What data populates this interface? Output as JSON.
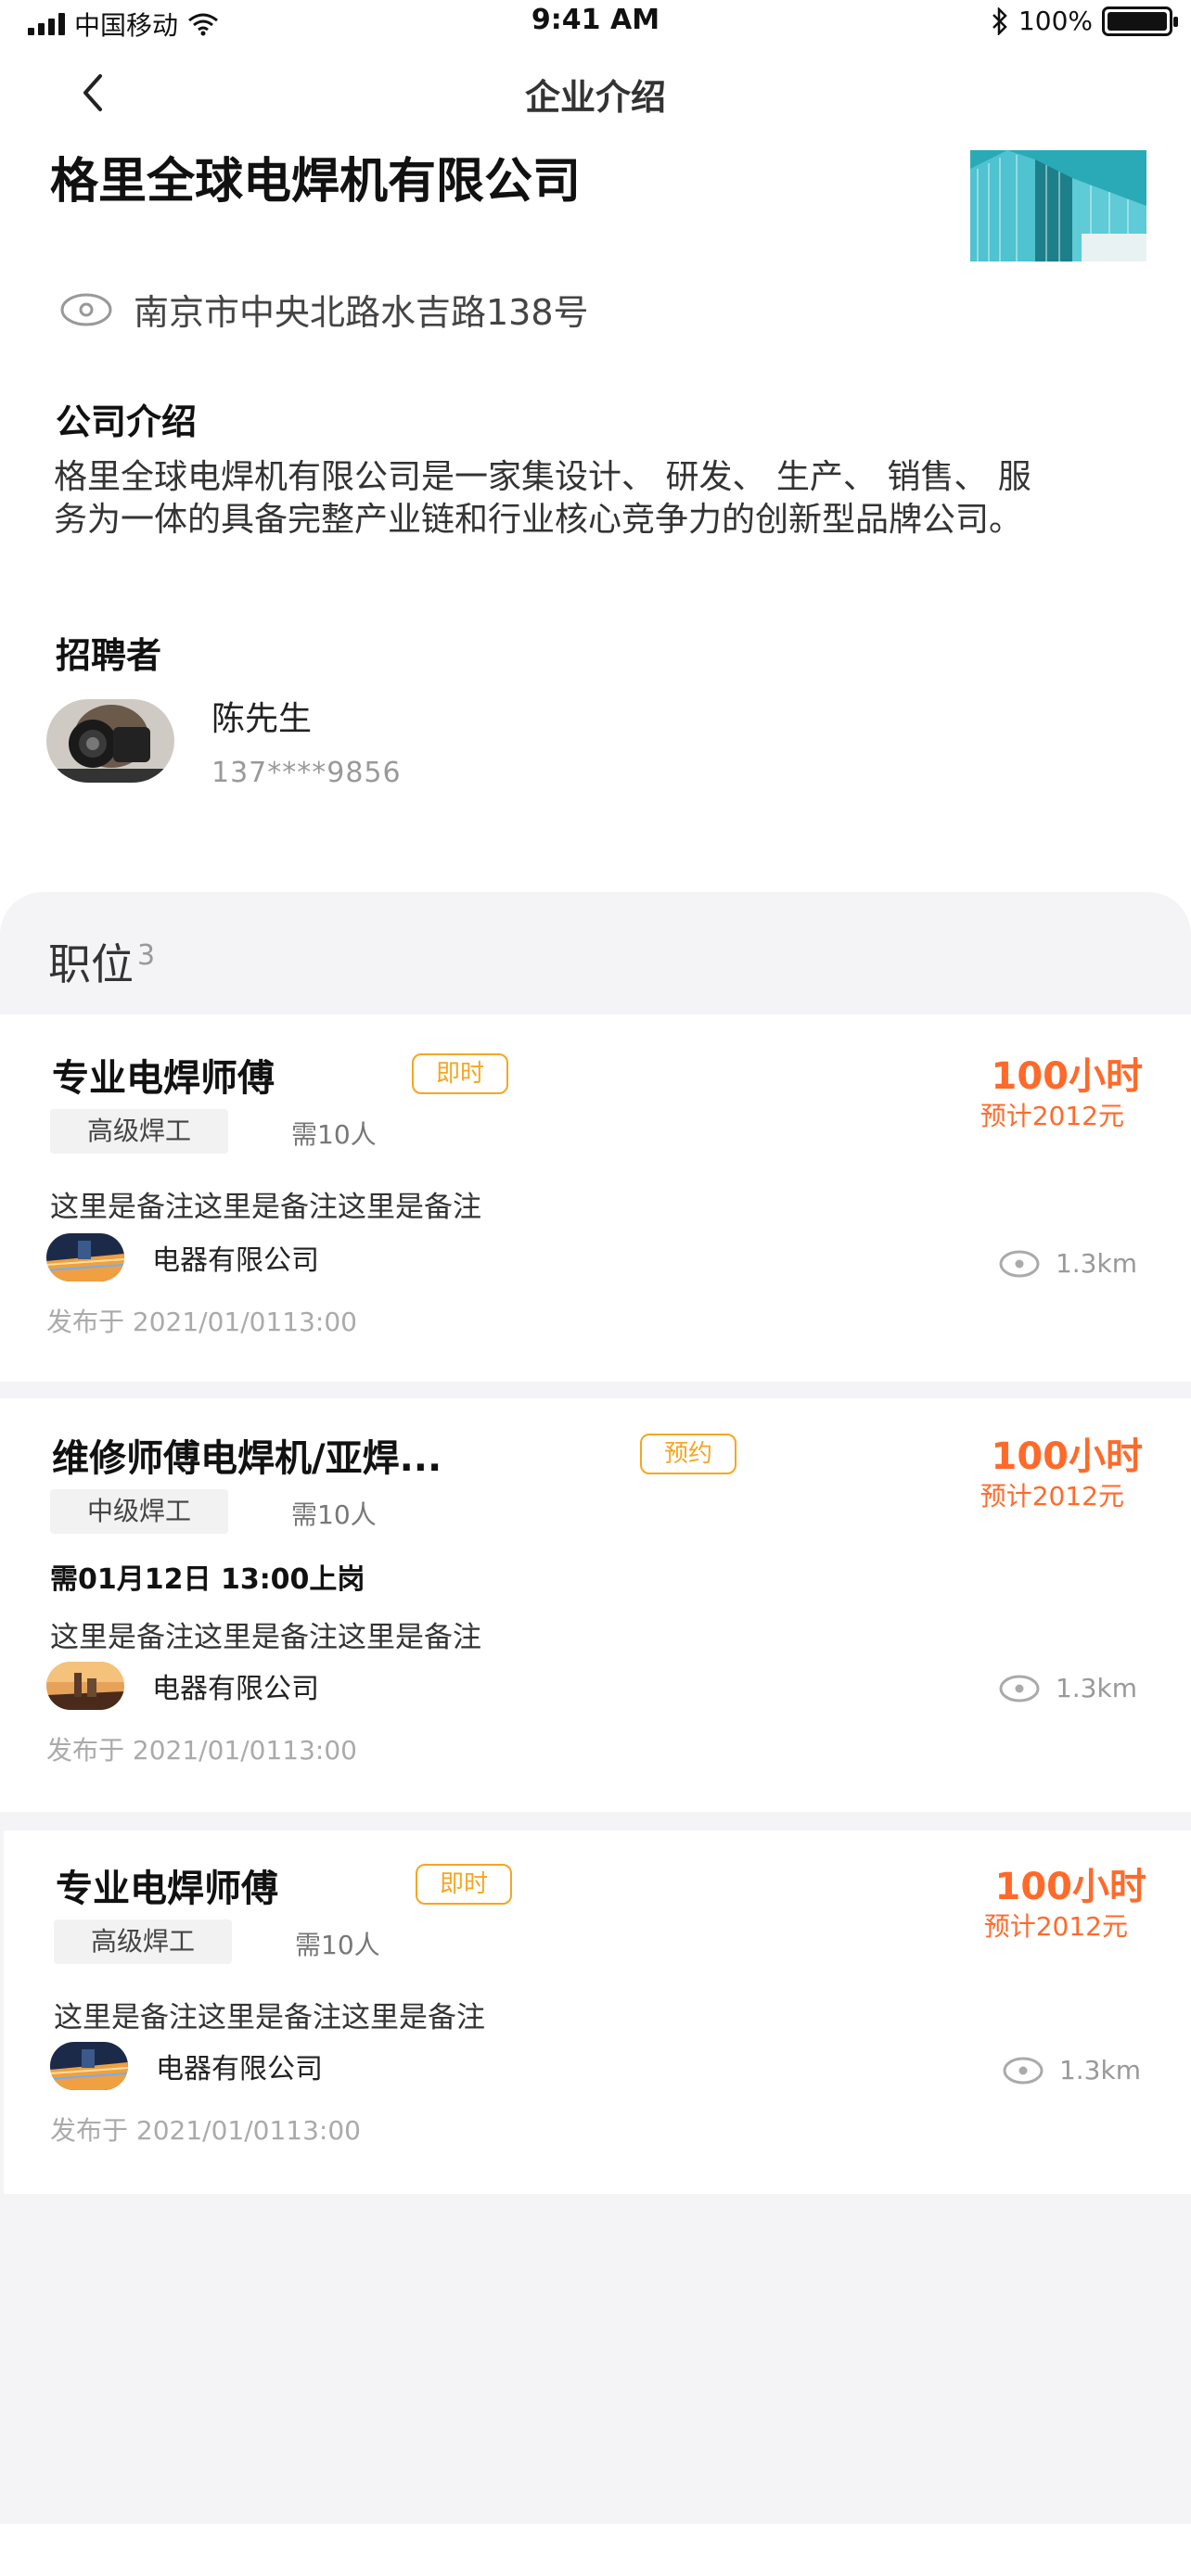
{
  "status_bar": {
    "carrier": "中国移动",
    "time": "9:41 AM",
    "battery": "100%"
  },
  "nav": {
    "title": "企业介绍"
  },
  "company": {
    "name": "格里全球电焊机有限公司",
    "address": "南京市中央北路水吉路138号"
  },
  "intro": {
    "title": "公司介绍",
    "text": "格里全球电焊机有限公司是一家集设计、 研发、 生产、 销售、 服务为一体的具备完整产业链和行业核心竞争力的创新型品牌公司。"
  },
  "recruiter": {
    "title": "招聘者",
    "name": "陈先生",
    "phone": "137****9856"
  },
  "positions": {
    "title": "职位",
    "count": "3",
    "items": [
      {
        "title": "专业电焊师傅",
        "tag": "即时",
        "hours": "100小时",
        "estimate": "预计2012元",
        "level": "高级焊工",
        "need": "需10人",
        "note": "这里是备注这里是备注这里是备注",
        "company": "电器有限公司",
        "distance": "1.3km",
        "date": "发布于 2021/01/0113:00"
      },
      {
        "title": "维修师傅电焊机/亚焊...",
        "tag": "预约",
        "hours": "100小时",
        "estimate": "预计2012元",
        "level": "中级焊工",
        "need": "需10人",
        "start": "需01月12日 13:00上岗",
        "note": "这里是备注这里是备注这里是备注",
        "company": "电器有限公司",
        "distance": "1.3km",
        "date": "发布于 2021/01/0113:00"
      },
      {
        "title": "专业电焊师傅",
        "tag": "即时",
        "hours": "100小时",
        "estimate": "预计2012元",
        "level": "高级焊工",
        "need": "需10人",
        "note": "这里是备注这里是备注这里是备注",
        "company": "电器有限公司",
        "distance": "1.3km",
        "date": "发布于 2021/01/0113:00"
      }
    ]
  },
  "colors": {
    "accent_orange": "#ff6a2a",
    "tag_orange": "#f5a623",
    "panel_bg": "#f4f4f6"
  },
  "icons": [
    "signal-icon",
    "wifi-icon",
    "bluetooth-icon",
    "battery-icon",
    "back-chevron-icon",
    "location-icon",
    "eye-icon"
  ]
}
